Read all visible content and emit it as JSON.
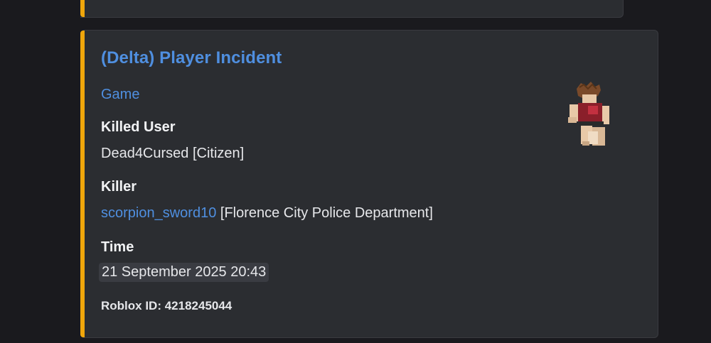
{
  "embed": {
    "accent_color": "#f0a60b",
    "title": "(Delta) Player Incident",
    "author_link": "Game",
    "fields": [
      {
        "name": "Killed User",
        "value": "Dead4Cursed [Citizen]"
      },
      {
        "name": "Killer",
        "value_link": "scorpion_sword10",
        "value_rest": " [Florence City Police Department]"
      },
      {
        "name": "Time",
        "value": "21 September 2025 20:43"
      }
    ],
    "footer": "Roblox ID: 4218245044",
    "thumbnail_icon": "roblox-avatar-thumbnail"
  }
}
